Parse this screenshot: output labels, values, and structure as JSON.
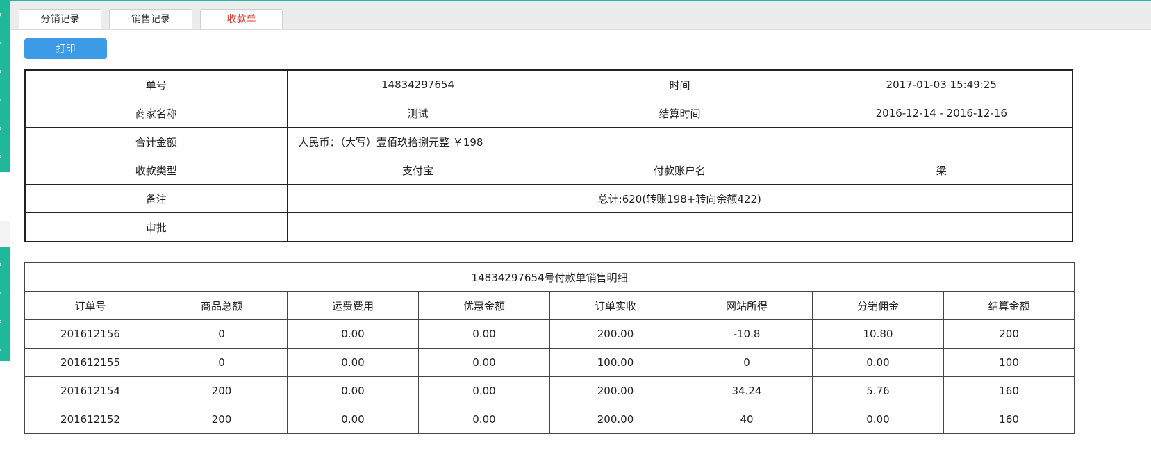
{
  "tabs": [
    {
      "label": "分销记录",
      "active": false
    },
    {
      "label": "销售记录",
      "active": false
    },
    {
      "label": "收款单",
      "active": true
    }
  ],
  "toolbar": {
    "print_label": "打印"
  },
  "receipt": {
    "order_no_label": "单号",
    "order_no": "14834297654",
    "time_label": "时间",
    "time": "2017-01-03 15:49:25",
    "merchant_label": "商家名称",
    "merchant": "测试",
    "settle_time_label": "结算时间",
    "settle_time": "2016-12-14 - 2016-12-16",
    "total_label": "合计金额",
    "total": "人民币：（大写）壹佰玖拾捌元整 ￥198",
    "payment_type_label": "收款类型",
    "payment_type": "支付宝",
    "payer_account_label": "付款账户名",
    "payer_account": "梁",
    "remark_label": "备注",
    "remark": "总计:620(转账198+转向余额422)",
    "approval_label": "审批",
    "approval": ""
  },
  "detail": {
    "title": "14834297654号付款单销售明细",
    "columns": [
      "订单号",
      "商品总额",
      "运费费用",
      "优惠金额",
      "订单实收",
      "网站所得",
      "分销佣金",
      "结算金额"
    ],
    "rows": [
      [
        "201612156",
        "0",
        "0.00",
        "0.00",
        "200.00",
        "-10.8",
        "10.80",
        "200"
      ],
      [
        "201612155",
        "0",
        "0.00",
        "0.00",
        "100.00",
        "0",
        "0.00",
        "100"
      ],
      [
        "201612154",
        "200",
        "0.00",
        "0.00",
        "200.00",
        "34.24",
        "5.76",
        "160"
      ],
      [
        "201612152",
        "200",
        "0.00",
        "0.00",
        "200.00",
        "40",
        "0.00",
        "160"
      ]
    ]
  },
  "sidebar": {
    "arrow_icon": "chevron-right-icon",
    "arrow_glyph": "›"
  },
  "colors": {
    "accent": "#1fb89a",
    "button": "#3d9ae6",
    "active_tab": "#e0392b"
  }
}
